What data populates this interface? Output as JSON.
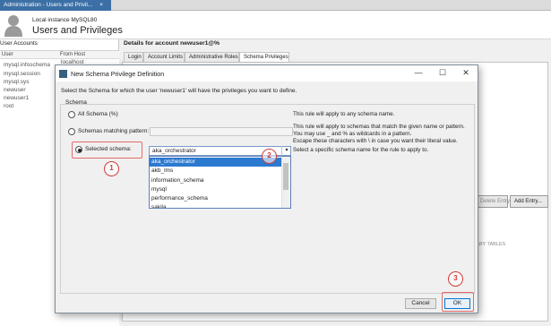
{
  "window": {
    "tab_title": "Administration - Users and Privil...",
    "tab_close": "×",
    "instance": "Local instance MySQL80",
    "page_title": "Users and Privileges"
  },
  "user_accounts": {
    "title": "User Accounts",
    "col_user": "User",
    "col_host": "From Host",
    "host_first": "localhost",
    "users": [
      "mysql.infoschema",
      "mysql.session",
      "mysql.sys",
      "newuser",
      "newuser1",
      "root"
    ]
  },
  "details": {
    "title": "Details for account newuser1@%",
    "tabs": [
      "Login",
      "Account Limits",
      "Administrative Roles",
      "Schema Privileges"
    ],
    "delete_entry": "Delete Entry",
    "add_entry": "Add Entry...",
    "misc_text": "ARY TABLES"
  },
  "dialog": {
    "title": "New Schema Privilege Definition",
    "minimize": "—",
    "maximize": "☐",
    "close": "✕",
    "instruction": "Select the Schema for which the user 'newuser1' will have the privileges you want to define.",
    "group_label": "Schema",
    "options": {
      "all": "All Schema (%)",
      "matching": "Schemas matching pattern:",
      "selected": "Selected schema:"
    },
    "help": {
      "all": "This rule will apply to any schema name.",
      "matching": [
        "This rule will apply to schemas that match the given name or pattern.",
        "You may use _ and % as wildcards in a pattern.",
        "Escape these characters with \\ in case you want their literal value."
      ],
      "selected": "Select a specific schema name for the rule to apply to."
    },
    "selected_value": "aka_orchestrator",
    "dropdown_items": [
      "aka_orchestrator",
      "akb_lms",
      "information_schema",
      "mysql",
      "performance_schema",
      "sakila"
    ],
    "cancel": "Cancel",
    "ok": "OK"
  },
  "callouts": [
    "1",
    "2",
    "3"
  ],
  "colors": {
    "accent": "#2c79d0",
    "annotation": "#d23b3b",
    "tab_active": "#3c6fa5"
  }
}
